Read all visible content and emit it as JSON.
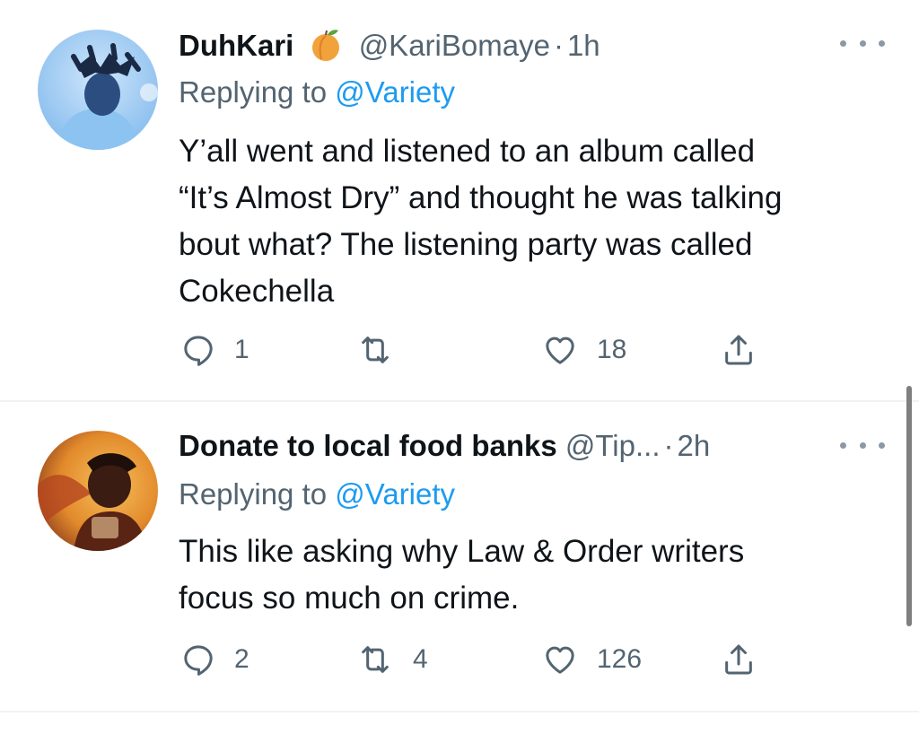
{
  "tweets": [
    {
      "display_name": "DuhKari",
      "emoji": "peach-emoji",
      "handle": "@KariBomaye",
      "separator": "·",
      "time": "1h",
      "reply_prefix": "Replying to",
      "reply_to": "@Variety",
      "body_lines": [
        "Y’all went and listened to an album called",
        "“It’s Almost Dry” and thought he was talking",
        "bout what? The listening party was called",
        "Cokechella"
      ],
      "replies": "1",
      "retweets": "",
      "likes": "18"
    },
    {
      "display_name": "Donate to local food banks",
      "handle": "@Tip...",
      "separator": "·",
      "time": "2h",
      "reply_prefix": "Replying to",
      "reply_to": "@Variety",
      "body_lines": [
        "This like asking why Law & Order writers",
        "focus so much on crime."
      ],
      "replies": "2",
      "retweets": "4",
      "likes": "126"
    }
  ],
  "icons": {
    "reply": "reply-icon",
    "retweet": "retweet-icon",
    "like": "heart-icon",
    "share": "share-icon",
    "more": "more-icon"
  },
  "colors": {
    "text": "#0f1419",
    "secondary": "#536471",
    "link": "#1d9bf0",
    "divider": "#eff3f4"
  }
}
